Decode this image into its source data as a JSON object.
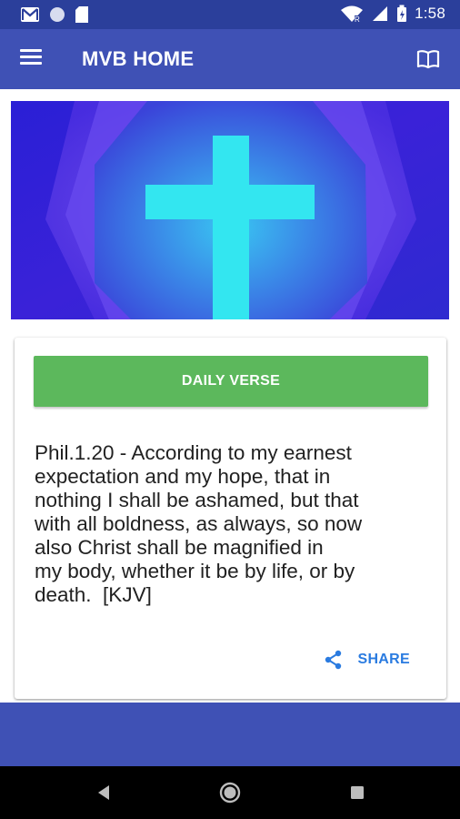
{
  "status_bar": {
    "time": "1:58",
    "left_icons": [
      "gmail-icon",
      "circle-icon",
      "sd-card-icon"
    ],
    "right_icons": [
      "wifi-icon",
      "signal-icon",
      "battery-icon"
    ]
  },
  "app_bar": {
    "title": "MVB HOME",
    "menu_icon": "hamburger-menu-icon",
    "action_icon": "book-icon"
  },
  "banner": {
    "icon": "cross-icon"
  },
  "card": {
    "button_label": "DAILY VERSE",
    "verse_text": "Phil.1.20 - According to my earnest\nexpectation and my hope, that in\nnothing I shall be ashamed, but that\nwith all boldness, as always, so now\nalso Christ shall be magnified in\nmy body, whether it be by life, or by\ndeath.  [KJV]",
    "share_label": "SHARE",
    "share_icon": "share-icon"
  },
  "colors": {
    "status_bar": "#2b3f9b",
    "app_bar": "#3f51b5",
    "daily_button": "#5cb85c",
    "share_text": "#2a7be0"
  },
  "nav_bar": {
    "icons": [
      "back-icon",
      "home-icon",
      "recents-icon"
    ]
  }
}
